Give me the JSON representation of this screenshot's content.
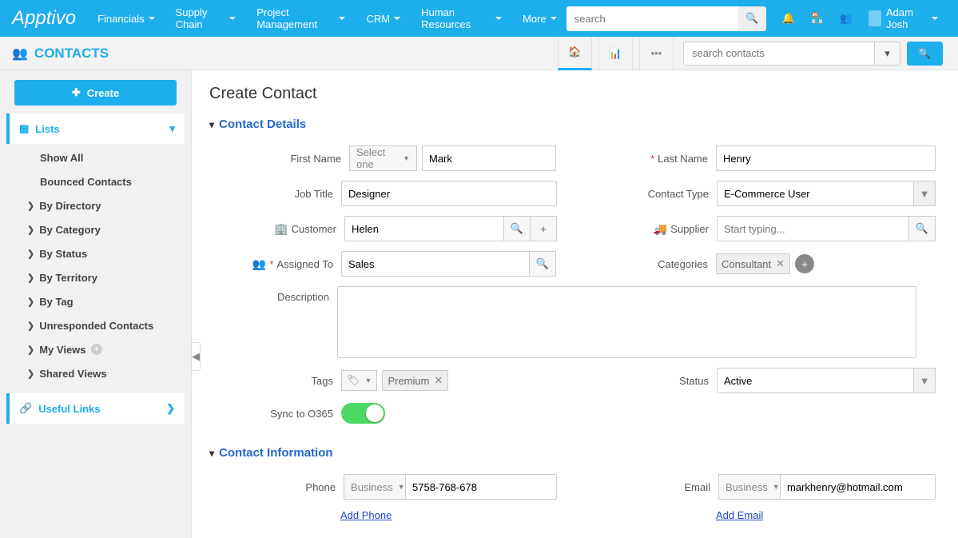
{
  "brand": "Apptivo",
  "topnav": {
    "items": [
      "Financials",
      "Supply Chain",
      "Project Management",
      "CRM",
      "Human Resources",
      "More"
    ],
    "search_placeholder": "search",
    "user": "Adam Josh"
  },
  "subheader": {
    "title": "CONTACTS",
    "search_placeholder": "search contacts"
  },
  "sidebar": {
    "create": "Create",
    "lists_label": "Lists",
    "items": [
      {
        "label": "Show All",
        "expandable": false
      },
      {
        "label": "Bounced Contacts",
        "expandable": false
      },
      {
        "label": "By Directory",
        "expandable": true
      },
      {
        "label": "By Category",
        "expandable": true
      },
      {
        "label": "By Status",
        "expandable": true
      },
      {
        "label": "By Territory",
        "expandable": true
      },
      {
        "label": "By Tag",
        "expandable": true
      },
      {
        "label": "Unresponded Contacts",
        "expandable": true
      },
      {
        "label": "My Views",
        "expandable": true,
        "add": true
      },
      {
        "label": "Shared Views",
        "expandable": true
      }
    ],
    "useful_links": "Useful Links"
  },
  "page": {
    "title": "Create Contact",
    "section_details": "Contact Details",
    "section_info": "Contact Information",
    "labels": {
      "first_name": "First Name",
      "last_name": "Last Name",
      "job_title": "Job Title",
      "contact_type": "Contact Type",
      "customer": "Customer",
      "supplier": "Supplier",
      "assigned_to": "Assigned To",
      "categories": "Categories",
      "description": "Description",
      "tags": "Tags",
      "status": "Status",
      "sync": "Sync to O365",
      "phone": "Phone",
      "email": "Email"
    },
    "values": {
      "salutation": "Select one",
      "first_name": "Mark",
      "last_name": "Henry",
      "job_title": "Designer",
      "contact_type": "E-Commerce User",
      "customer": "Helen",
      "supplier_placeholder": "Start typing...",
      "assigned_to": "Sales",
      "category_tag": "Consultant",
      "tag": "Premium",
      "status": "Active",
      "phone_type": "Business",
      "phone": "5758-768-678",
      "email_type": "Business",
      "email": "markhenry@hotmail.com",
      "add_phone": "Add Phone",
      "add_email": "Add Email"
    }
  }
}
